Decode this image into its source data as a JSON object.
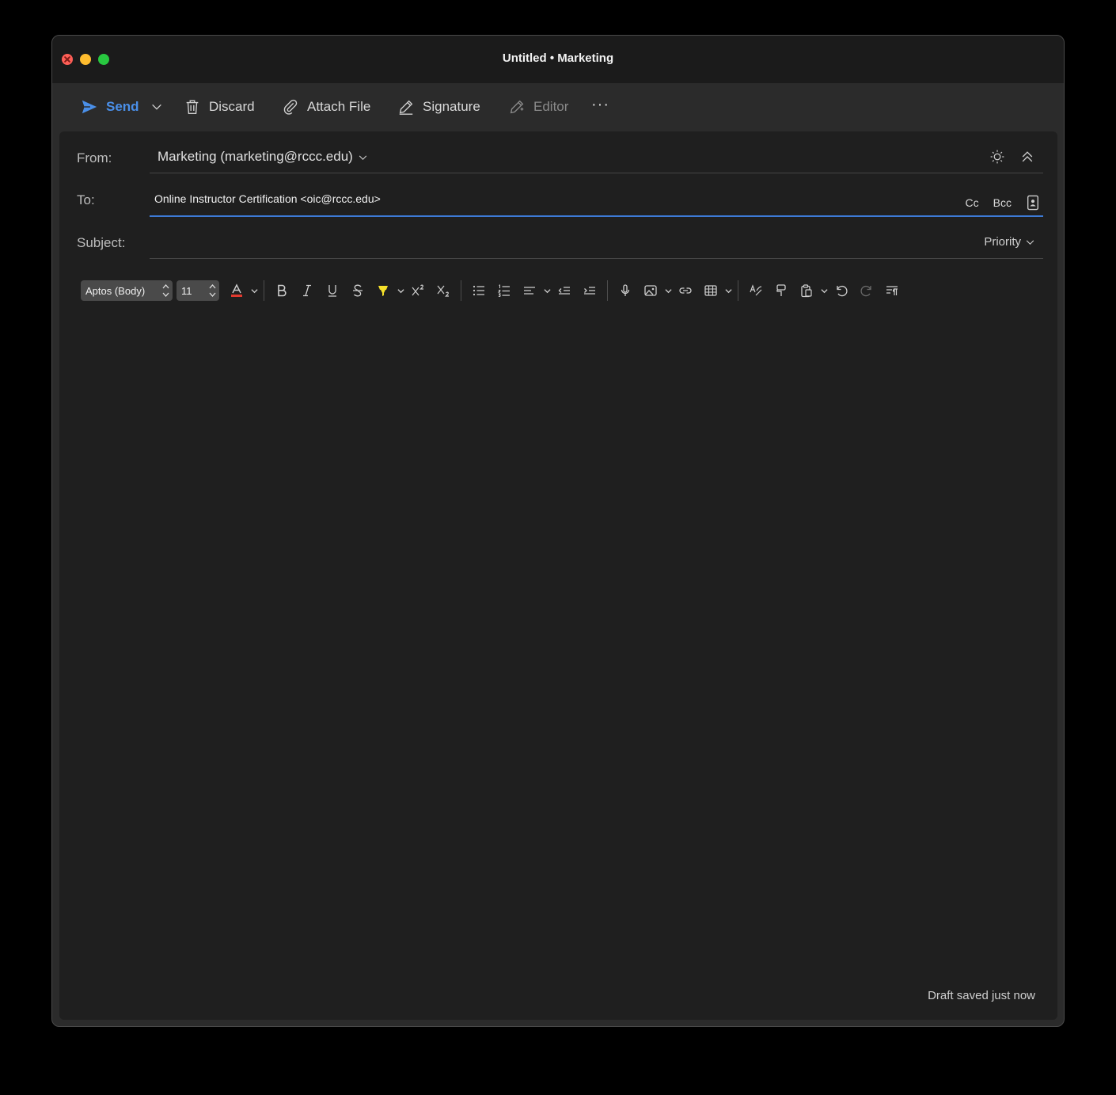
{
  "window": {
    "title": "Untitled • Marketing"
  },
  "toolbar": {
    "send_label": "Send",
    "discard_label": "Discard",
    "attach_label": "Attach File",
    "signature_label": "Signature",
    "editor_label": "Editor",
    "more_label": "···"
  },
  "from": {
    "label": "From:",
    "value": "Marketing (marketing@rccc.edu)"
  },
  "to": {
    "label": "To:",
    "value": "Online Instructor Certification <oic@rccc.edu>",
    "cc_label": "Cc",
    "bcc_label": "Bcc"
  },
  "subject": {
    "label": "Subject:",
    "value": "",
    "priority_label": "Priority"
  },
  "format": {
    "font": "Aptos (Body)",
    "size": "11"
  },
  "status": {
    "draft": "Draft saved just now"
  },
  "colors": {
    "accent": "#4a8fe8",
    "font_color_swatch": "#e03a2f",
    "highlight_swatch": "#f5e02a"
  }
}
